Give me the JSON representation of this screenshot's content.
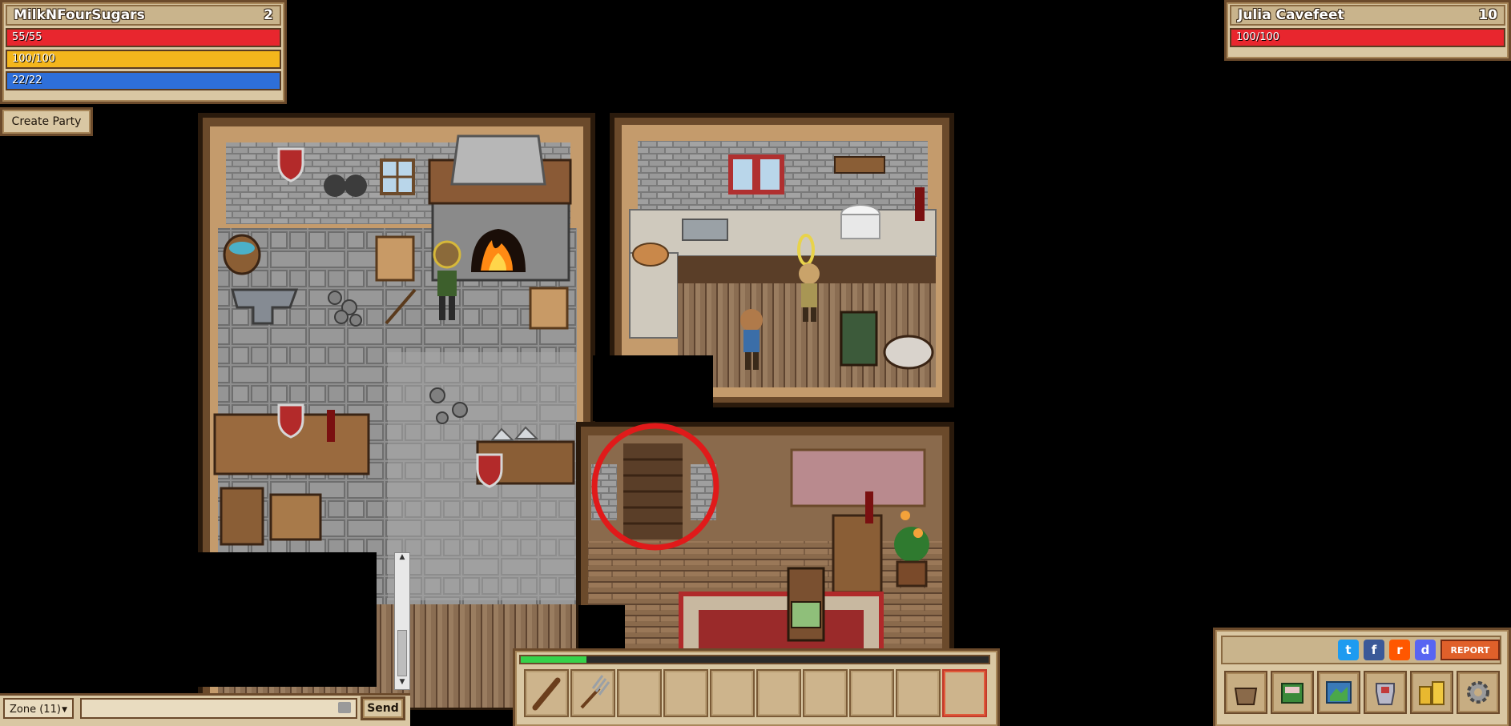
{
  "player": {
    "name": "MilkNFourSugars",
    "level": "2",
    "hp": "55/55",
    "hp_fraction": 1.0,
    "stamina": "100/100",
    "stamina_fraction": 1.0,
    "mana": "22/22",
    "mana_fraction": 1.0
  },
  "target": {
    "name": "Julia Cavefeet",
    "level": "10",
    "hp": "100/100",
    "hp_fraction": 1.0
  },
  "party": {
    "create_label": "Create Party"
  },
  "chat": {
    "channel": "Zone (11)",
    "send_label": "Send",
    "input_value": ""
  },
  "hotbar": {
    "xp_fraction": 0.14,
    "slots": [
      "wooden-club-icon",
      "pitchfork-icon",
      "",
      "",
      "",
      "",
      "",
      "",
      "",
      ""
    ],
    "selected_index": 9
  },
  "menu": {
    "report_label": "REPORT",
    "social": [
      "twitter-icon",
      "facebook-icon",
      "reddit-icon",
      "discord-icon"
    ],
    "buttons": [
      "inventory-bag-icon",
      "quest-book-icon",
      "world-map-icon",
      "character-armor-icon",
      "gold-coins-icon",
      "settings-gear-icon"
    ]
  },
  "colors": {
    "hp": "#e8262e",
    "stamina": "#f4b61c",
    "mana": "#2e6fd9",
    "xp": "#35d24a",
    "highlight_circle": "#e01a1a"
  }
}
